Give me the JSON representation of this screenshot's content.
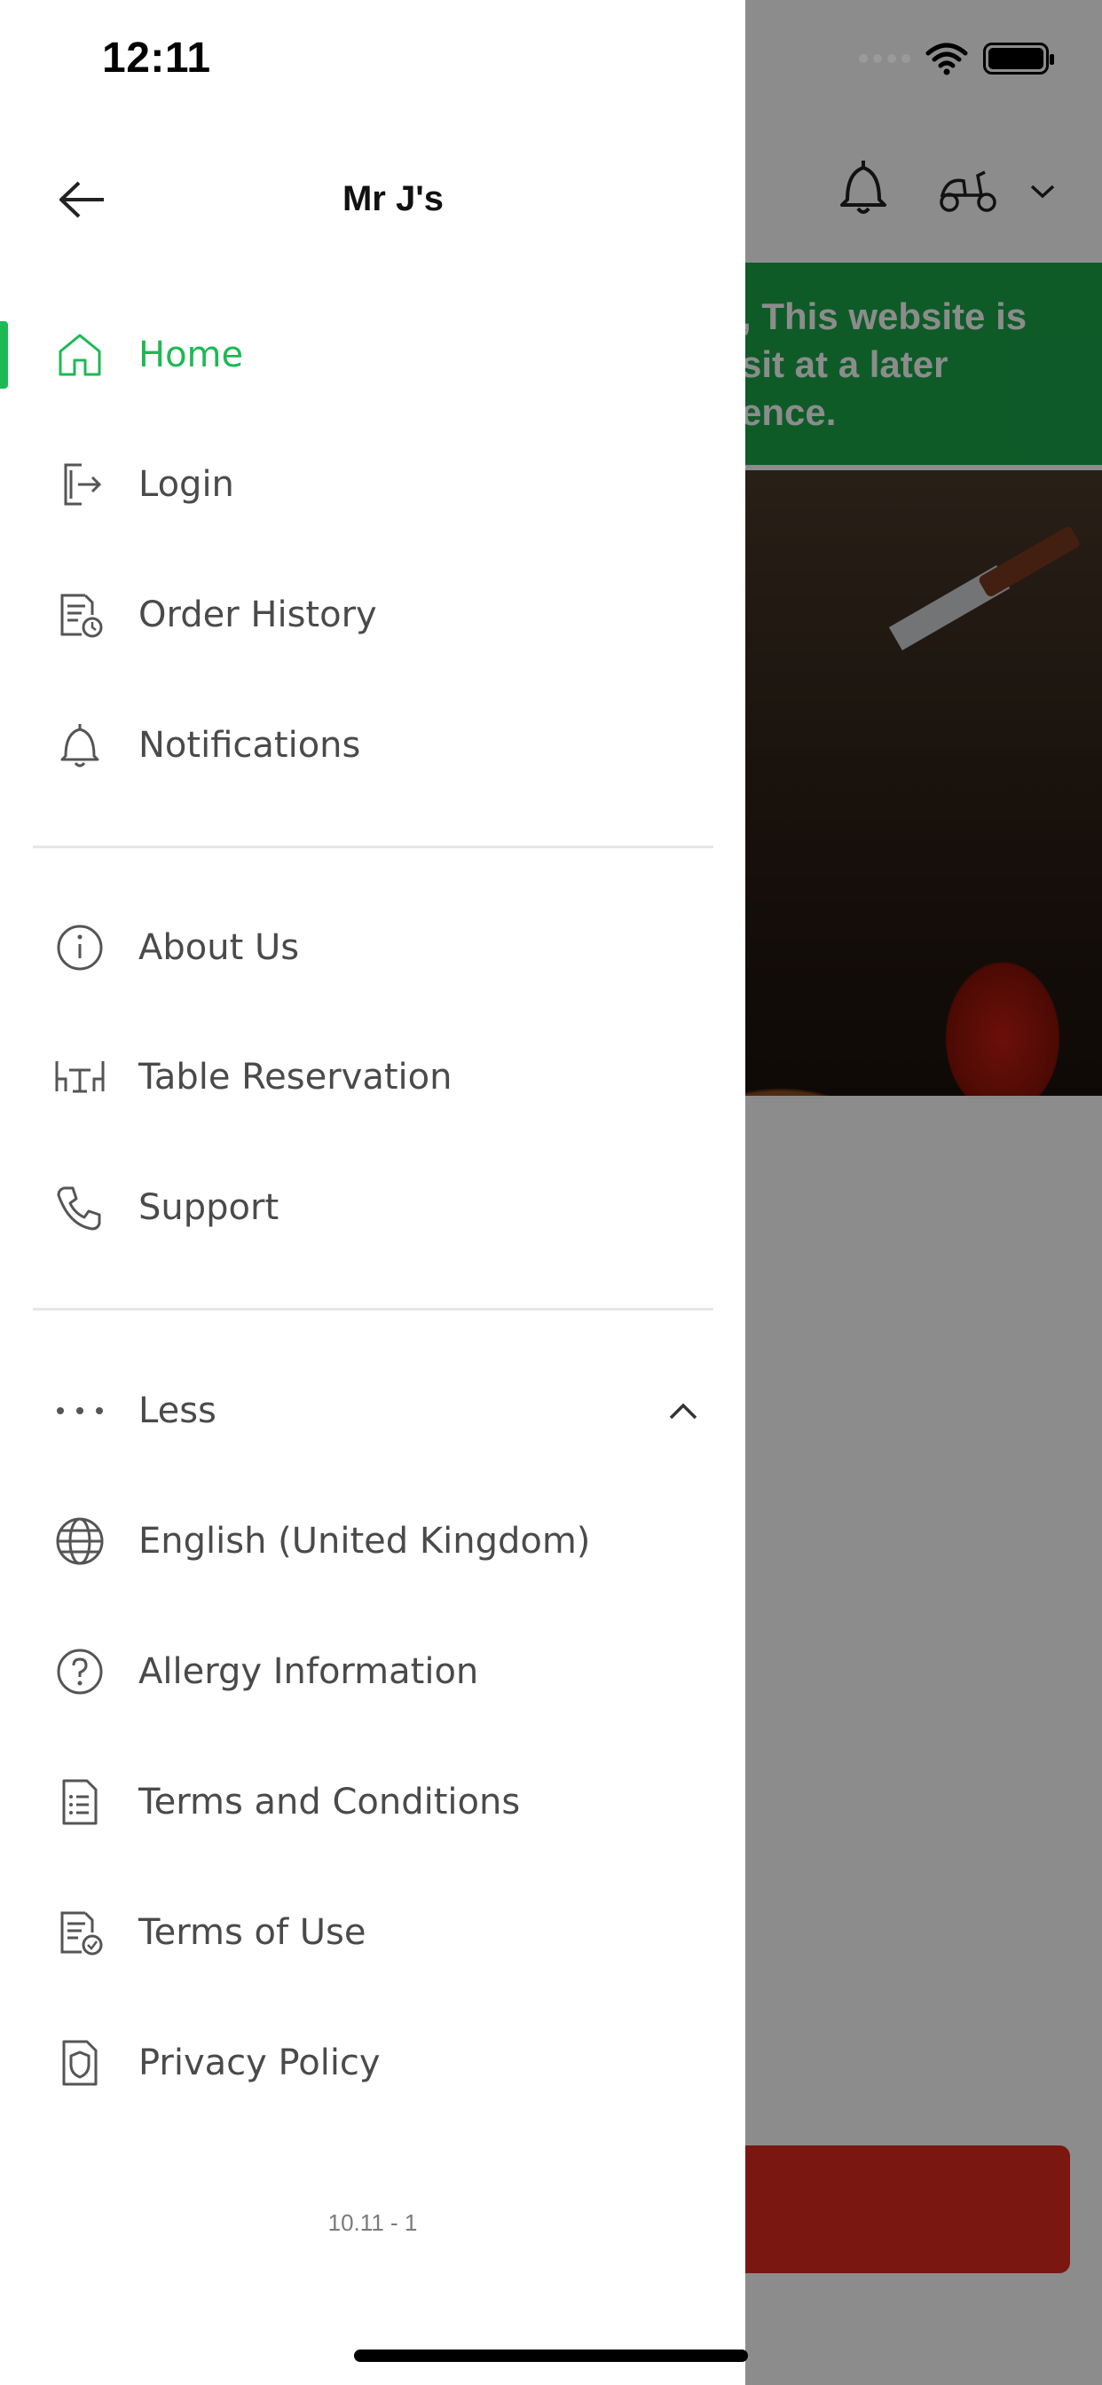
{
  "status_bar": {
    "time": "12:11"
  },
  "drawer": {
    "title": "Mr J's",
    "back_icon": "arrow-left-icon",
    "accent_color": "#1db954",
    "items_primary": [
      {
        "label": "Home",
        "icon": "home-icon",
        "active": true
      },
      {
        "label": "Login",
        "icon": "login-icon"
      },
      {
        "label": "Order History",
        "icon": "order-history-icon"
      },
      {
        "label": "Notifications",
        "icon": "bell-icon"
      }
    ],
    "items_secondary": [
      {
        "label": "About Us",
        "icon": "info-icon"
      },
      {
        "label": "Table Reservation",
        "icon": "table-icon"
      },
      {
        "label": "Support",
        "icon": "phone-icon"
      }
    ],
    "more_toggle": {
      "label": "Less",
      "icon": "more-dots-icon",
      "state": "expanded"
    },
    "items_more": [
      {
        "label": "English (United Kingdom)",
        "icon": "globe-icon"
      },
      {
        "label": "Allergy Information",
        "icon": "help-circle-icon"
      },
      {
        "label": "Terms and Conditions",
        "icon": "document-list-icon"
      },
      {
        "label": "Terms of Use",
        "icon": "document-check-icon"
      },
      {
        "label": "Privacy Policy",
        "icon": "shield-document-icon"
      }
    ],
    "version": "10.11 - 1"
  },
  "background_app": {
    "banner_text": ", This website is\nsit at a later\nence.",
    "banner_color": "#1aa64a",
    "icons": [
      "bell-icon",
      "scooter-icon",
      "chevron-down-icon"
    ],
    "action_button_color": "#e02a20"
  }
}
